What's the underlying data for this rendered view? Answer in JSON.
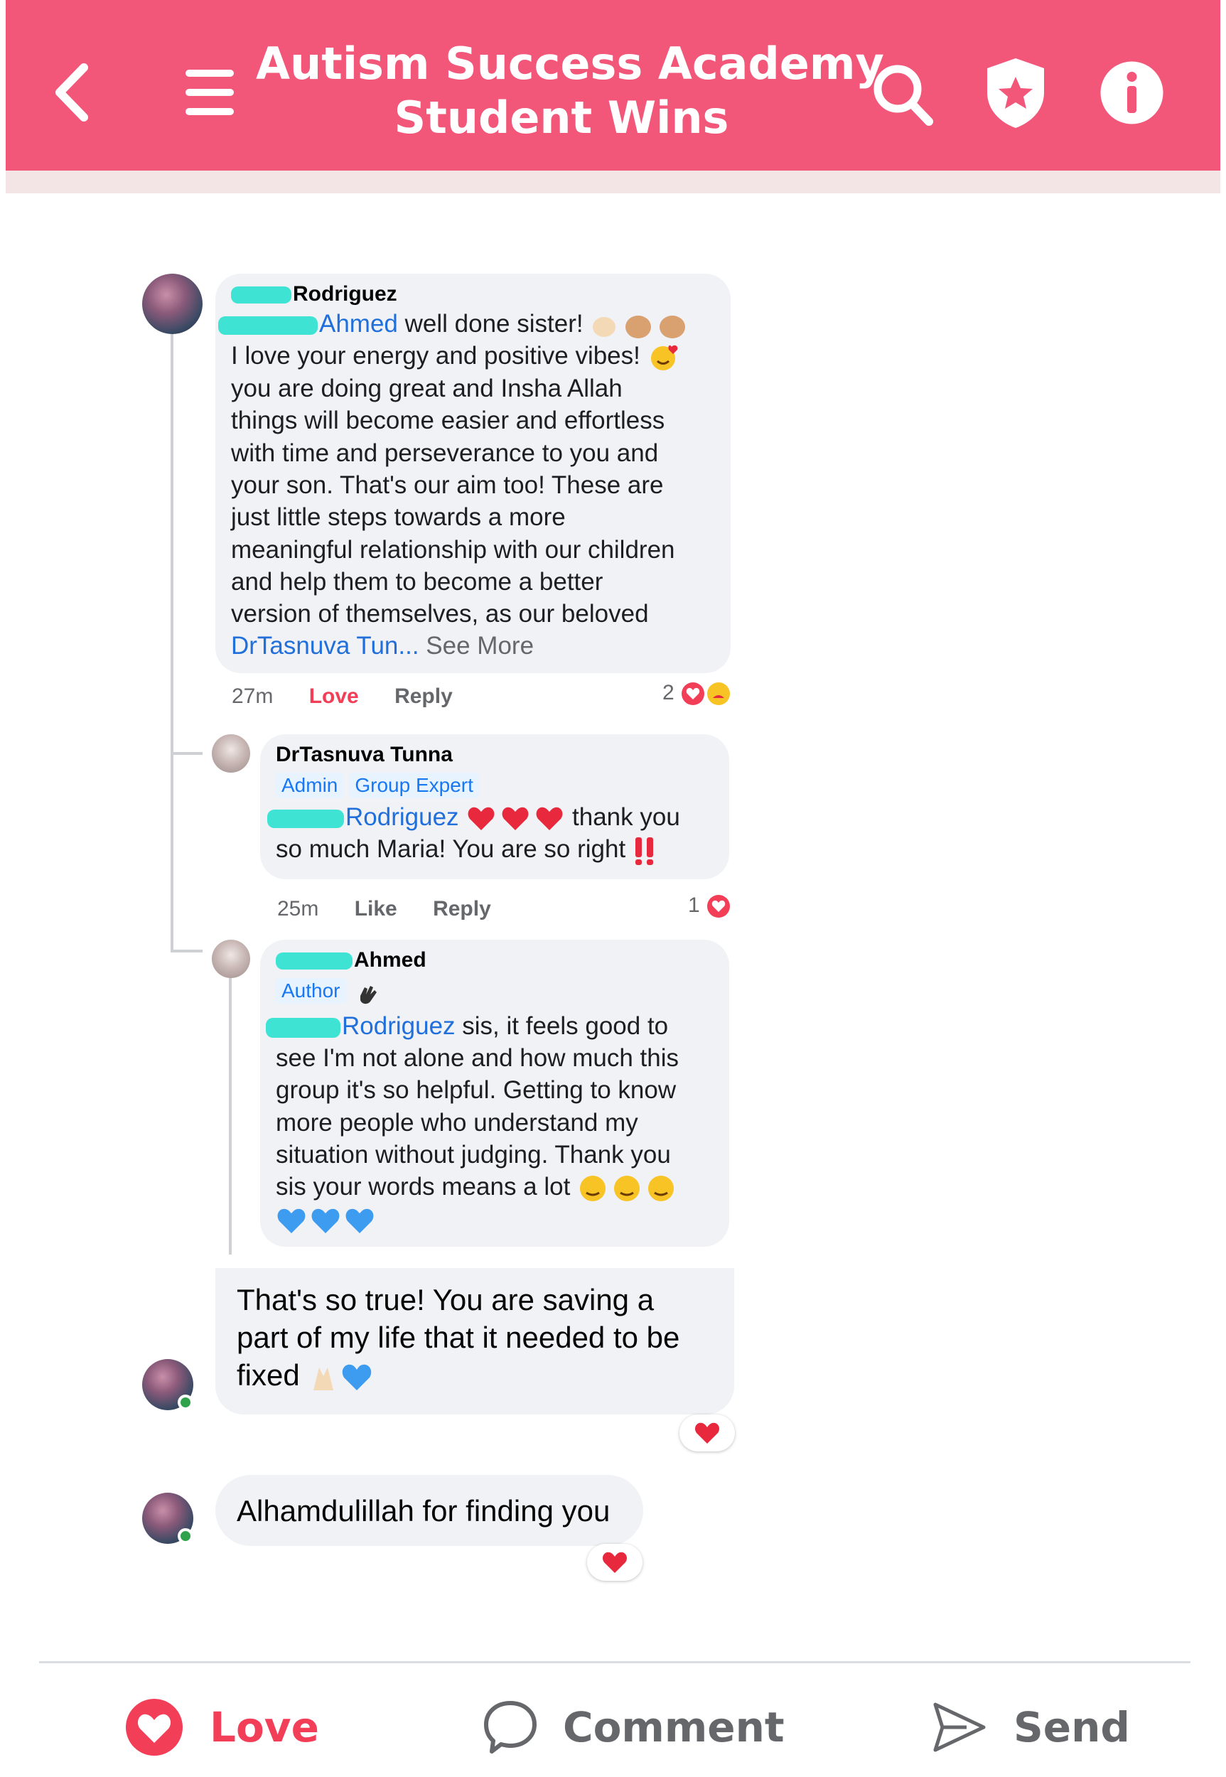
{
  "header": {
    "title_line1": "Autism Success Academy",
    "title_line2": "Student Wins",
    "icons": [
      "back-icon",
      "menu-icon",
      "search-icon",
      "badge-icon",
      "info-icon"
    ]
  },
  "comments": [
    {
      "author_suffix": "Rodriguez",
      "mention": "Ahmed",
      "text_line1": " well done sister!",
      "text_lines": [
        "I love your energy and positive vibes!",
        "you are doing great and Insha Allah",
        "things will become easier and effortless",
        "with time and perseverance to you and",
        "your son. That's our aim too! These are",
        "just little steps towards a more",
        "meaningful relationship with our children",
        "and help them to become a better",
        "version of themselves, as our beloved"
      ],
      "mention_end": "DrTasnuva Tun...",
      "see_more": " See More",
      "time": "27m",
      "action_react": "Love",
      "action_reply": "Reply",
      "reaction_count": "2"
    },
    {
      "author": "DrTasnuva Tunna",
      "tags": [
        "Admin",
        "Group Expert"
      ],
      "mention": "Rodriguez",
      "text_line1": " thank you",
      "text_line2": "so much Maria! You are so right",
      "time": "25m",
      "action_react": "Like",
      "action_reply": "Reply",
      "reaction_count": "1"
    },
    {
      "author_suffix": "Ahmed",
      "tags": [
        "Author"
      ],
      "mention": "Rodriguez",
      "text_line1": " sis, it feels good to",
      "text_lines": [
        "see I'm not alone and how much this",
        "group it's so helpful. Getting to know",
        "more people who understand my",
        "situation without judging. Thank you",
        "sis your words means a lot"
      ]
    },
    {
      "text_lines": [
        "That's so true! You are saving a",
        "part of my life that it needed to be",
        "fixed"
      ]
    },
    {
      "text": "Alhamdulillah for finding you"
    }
  ],
  "footer": {
    "love_label": "Love",
    "comment_label": "Comment",
    "send_label": "Send"
  },
  "colors": {
    "header_bg": "#f2577a",
    "love_red": "#f33e58",
    "mention_blue": "#216fdb",
    "bubble_bg": "#f0f2f5"
  }
}
